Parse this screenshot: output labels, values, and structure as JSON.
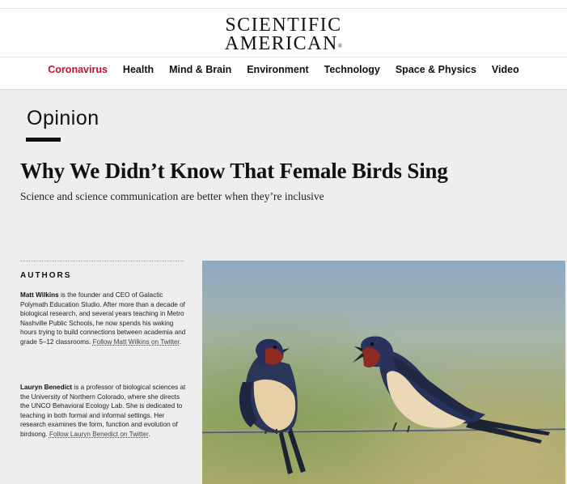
{
  "header": {
    "logo_line1": "SCIENTIFIC",
    "logo_line2": "AMERICAN",
    "logo_mark": "®"
  },
  "nav": {
    "items": [
      {
        "label": "Coronavirus",
        "color": "#c8102e"
      },
      {
        "label": "Health"
      },
      {
        "label": "Mind & Brain"
      },
      {
        "label": "Environment"
      },
      {
        "label": "Technology"
      },
      {
        "label": "Space & Physics"
      },
      {
        "label": "Video"
      }
    ]
  },
  "article": {
    "section": "Opinion",
    "headline": "Why We Didn’t Know That Female Birds Sing",
    "dek": "Science and science communication are better when they’re inclusive"
  },
  "authors": {
    "heading": "AUTHORS",
    "list": [
      {
        "name": "Matt Wilkins",
        "bio": " is the founder and CEO of Galactic Polymath Education Studio. After more than a decade of biological research, and several years teaching in Metro Nashville Public Schools, he now spends his waking hours trying to build connections between academia and grade 5–12 classrooms. ",
        "twitter_link": "Follow Matt Wilkins on Twitter",
        "tail": "."
      },
      {
        "name": "Lauryn Benedict",
        "bio": " is a professor of biological sciences at the University of Northern Colorado, where she directs the UNCO Behavioral Ecology Lab. She is dedicated to teaching in both formal and informal settings. Her research examines the form, function and evolution of birdsong. ",
        "twitter_link": "Follow Lauryn Benedict on Twitter",
        "tail": "."
      }
    ]
  },
  "hero_image": {
    "subject": "two-barn-swallows-on-wire"
  }
}
